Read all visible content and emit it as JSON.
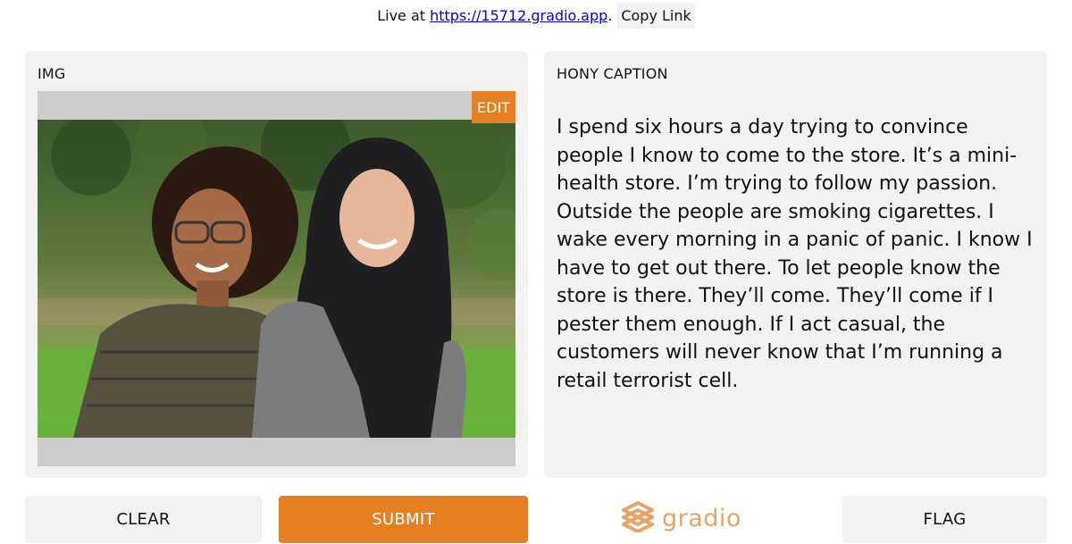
{
  "topbar": {
    "live_prefix": "Live at",
    "live_url": "https://15712.gradio.app",
    "live_suffix": ".",
    "copy_label": "Copy Link"
  },
  "input_panel": {
    "label": "IMG",
    "edit_label": "EDIT"
  },
  "output_panel": {
    "label": "HONY CAPTION",
    "caption": "I spend six hours a day trying to convince people I know to come to the store. It’s a mini-health store. I’m trying to follow my passion. Outside the people are smoking cigarettes. I wake every morning in a panic of panic. I know I have to get out there. To let people know the store is there. They’ll come. They’ll come if I pester them enough. If I act casual, the customers will never know that I’m running a retail terrorist cell."
  },
  "buttons": {
    "clear_label": "CLEAR",
    "submit_label": "SUBMIT",
    "flag_label": "FLAG"
  },
  "brand": {
    "name": "gradio"
  },
  "colors": {
    "accent": "#e67e22",
    "panel_bg": "#f2f2f2",
    "image_bg": "#cccccc",
    "brand_text": "#e8a265"
  }
}
